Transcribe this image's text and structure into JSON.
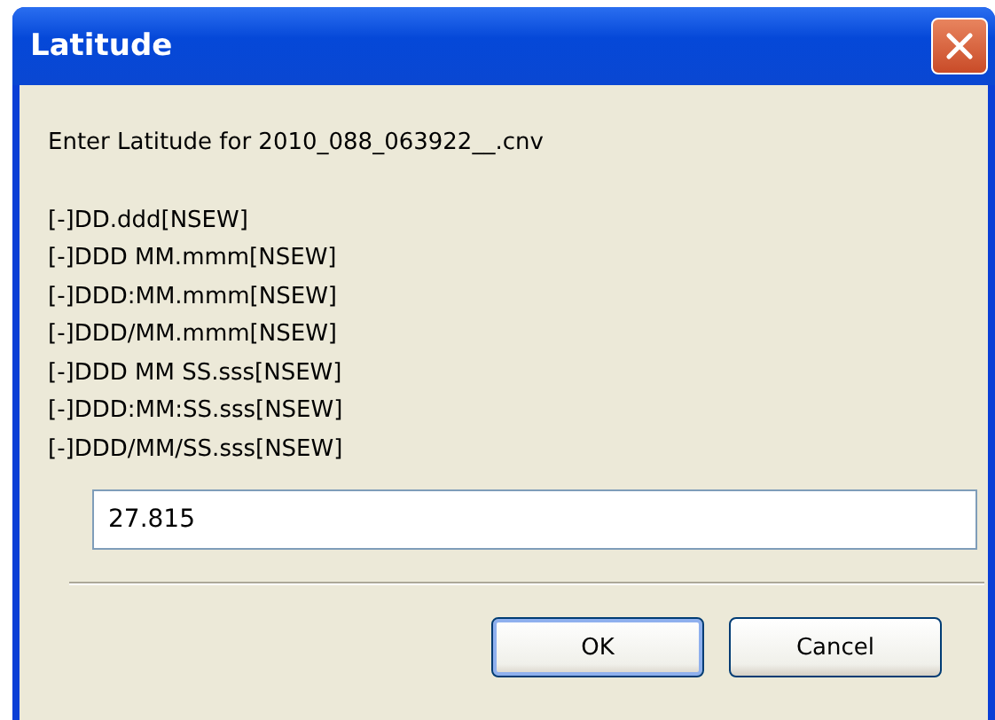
{
  "window": {
    "title": "Latitude"
  },
  "prompt": "Enter Latitude for 2010_088_063922__.cnv",
  "formats": [
    "[-]DD.ddd[NSEW]",
    "[-]DDD MM.mmm[NSEW]",
    "[-]DDD:MM.mmm[NSEW]",
    "[-]DDD/MM.mmm[NSEW]",
    "[-]DDD MM SS.sss[NSEW]",
    "[-]DDD:MM:SS.sss[NSEW]",
    "[-]DDD/MM/SS.sss[NSEW]"
  ],
  "input": {
    "value": "27.815"
  },
  "buttons": [
    {
      "label": "OK",
      "kind": "default"
    },
    {
      "label": "Cancel",
      "kind": "normal"
    }
  ]
}
